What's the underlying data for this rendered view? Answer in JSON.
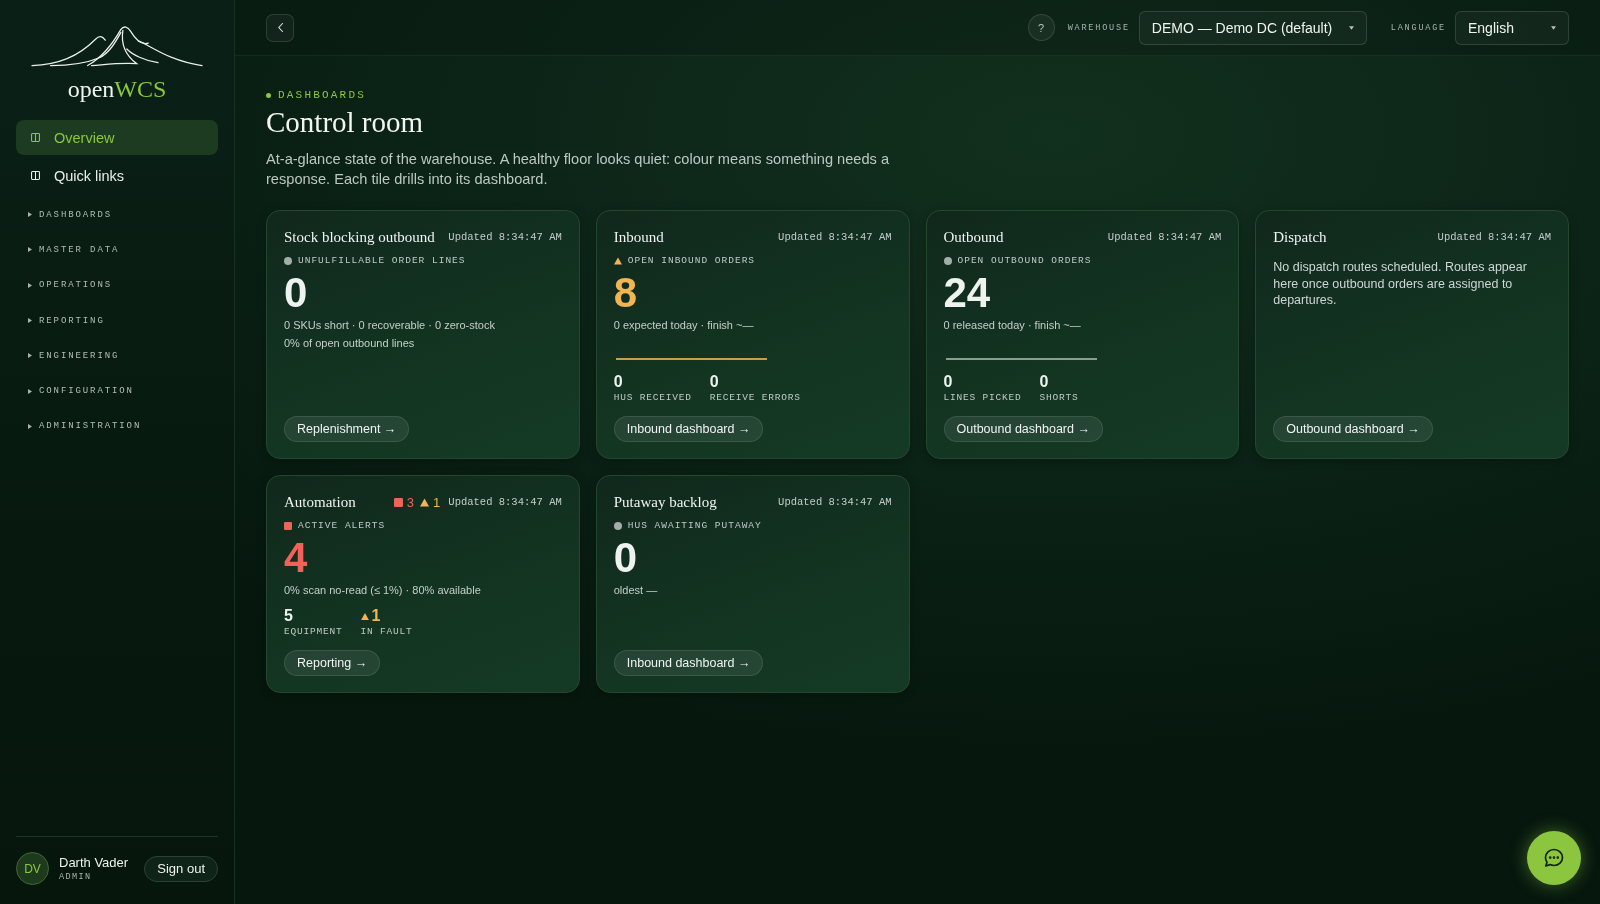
{
  "sidebar": {
    "brand": {
      "name": "open",
      "accent": "WCS"
    },
    "nav": [
      {
        "label": "Overview",
        "selected": true
      },
      {
        "label": "Quick links",
        "selected": false
      }
    ],
    "sections": [
      {
        "label": "DASHBOARDS",
        "expanded": false
      },
      {
        "label": "MASTER DATA",
        "expanded": false
      },
      {
        "label": "OPERATIONS",
        "expanded": false
      },
      {
        "label": "REPORTING",
        "expanded": false
      },
      {
        "label": "ENGINEERING",
        "expanded": false
      },
      {
        "label": "CONFIGURATION",
        "expanded": false
      },
      {
        "label": "ADMINISTRATION",
        "expanded": false
      }
    ],
    "user": {
      "initials": "DV",
      "name": "Darth Vader",
      "role": "ADMIN"
    },
    "sign_out": "Sign out"
  },
  "header": {
    "help": "?",
    "warehouse": {
      "label": "WAREHOUSE",
      "value": "DEMO — Demo DC (default)"
    },
    "language": {
      "label": "LANGUAGE",
      "value": "English"
    }
  },
  "page": {
    "eyebrow": "DASHBOARDS",
    "title": "Control room",
    "description": "At-a-glance state of the warehouse. A healthy floor looks quiet: colour means something needs a response. Each tile drills into its dashboard."
  },
  "tiles": [
    {
      "kind": "metric",
      "title": "Stock blocking outbound",
      "updated": "Updated 8:34:47 AM",
      "metric": {
        "label": "UNFULFILLABLE ORDER LINES",
        "value": "0",
        "kind": "neutral"
      },
      "lines": [
        "0 SKUs short · 0 recoverable · 0 zero-stock",
        "0% of open outbound lines"
      ],
      "link": "Replenishment →"
    },
    {
      "kind": "metric",
      "title": "Inbound",
      "updated": "Updated 8:34:47 AM",
      "metric": {
        "label": "OPEN INBOUND ORDERS",
        "value": "8",
        "kind": "warning"
      },
      "lines": [
        "0 expected today · finish ~—"
      ],
      "progress": {
        "level": 1
      },
      "stats": [
        {
          "value": "0",
          "label": "HUS RECEIVED",
          "kind": "neutral"
        },
        {
          "value": "0",
          "label": "RECEIVE ERRORS",
          "kind": "neutral"
        }
      ],
      "link": "Inbound dashboard →"
    },
    {
      "kind": "metric",
      "title": "Outbound",
      "updated": "Updated 8:34:47 AM",
      "metric": {
        "label": "OPEN OUTBOUND ORDERS",
        "value": "24",
        "kind": "neutral"
      },
      "lines": [
        "0 released today · finish ~—"
      ],
      "progress": {
        "level": 1
      },
      "stats": [
        {
          "value": "0",
          "label": "LINES PICKED",
          "kind": "neutral"
        },
        {
          "value": "0",
          "label": "SHORTS",
          "kind": "neutral"
        }
      ],
      "link": "Outbound dashboard →"
    },
    {
      "kind": "message",
      "title": "Dispatch",
      "updated": "Updated 8:34:47 AM",
      "message": "No dispatch routes scheduled. Routes appear here once outbound orders are assigned to departures.",
      "link": "Outbound dashboard →"
    },
    {
      "kind": "metric",
      "title": "Automation",
      "badges": [
        {
          "count": "3",
          "kind": "critical"
        },
        {
          "count": "1",
          "kind": "warning"
        }
      ],
      "updated": "Updated 8:34:47 AM",
      "metric": {
        "label": "ACTIVE ALERTS",
        "value": "4",
        "kind": "critical"
      },
      "lines": [
        "0% scan no-read (≤ 1%) · 80% available"
      ],
      "stats": [
        {
          "value": "5",
          "label": "EQUIPMENT",
          "kind": "neutral"
        },
        {
          "value": "1",
          "label": "IN FAULT",
          "kind": "warning"
        }
      ],
      "link": "Reporting →"
    },
    {
      "kind": "metric",
      "title": "Putaway backlog",
      "updated": "Updated 8:34:47 AM",
      "metric": {
        "label": "HUS AWAITING PUTAWAY",
        "value": "0",
        "kind": "neutral"
      },
      "lines": [
        "oldest —"
      ],
      "link": "Inbound dashboard →"
    }
  ]
}
